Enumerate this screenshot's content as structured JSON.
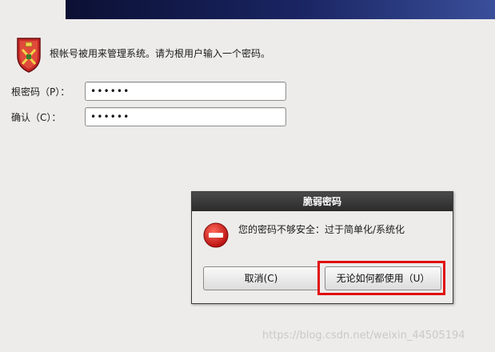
{
  "intro": {
    "message": "根帐号被用来管理系统。请为根用户输入一个密码。"
  },
  "form": {
    "root_password_label": "根密码（P）：",
    "root_password_value": "••••••",
    "confirm_label": "确认（C）：",
    "confirm_value": "••••••"
  },
  "dialog": {
    "title": "脆弱密码",
    "message": "您的密码不够安全：过于简单化/系统化",
    "cancel_label": "取消(C)",
    "use_anyway_label": "无论如何都使用（U）"
  },
  "watermark": "https://blog.csdn.net/weixin_44505194",
  "colors": {
    "banner": "#1a2563",
    "error_red": "#d81e1e",
    "highlight": "#e01010",
    "titlebar": "#2b2b2b"
  },
  "icons": {
    "shield": "shield-icon",
    "error": "error-icon"
  }
}
